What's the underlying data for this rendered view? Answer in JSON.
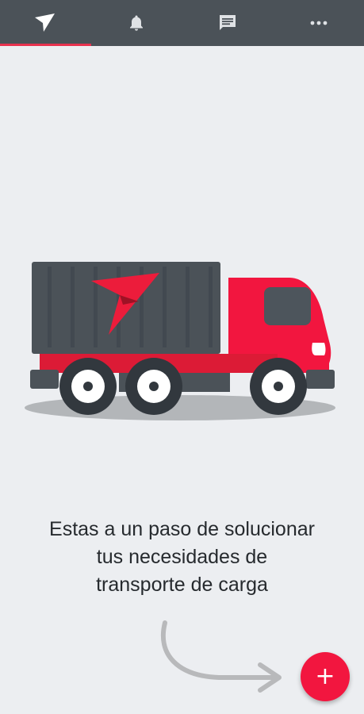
{
  "tabs": [
    {
      "icon": "send-arrow-icon",
      "active": true
    },
    {
      "icon": "bell-icon",
      "active": false
    },
    {
      "icon": "chat-icon",
      "active": false
    },
    {
      "icon": "more-dots-icon",
      "active": false
    }
  ],
  "empty_state": {
    "illustration": "cargo-truck-illustration",
    "message_lines": [
      "Estas a un paso de solucionar",
      "tus necesidades de",
      "transporte de carga"
    ]
  },
  "fab": {
    "label": "+",
    "icon": "plus-icon"
  },
  "colors": {
    "topbar": "#4b5258",
    "accent": "#f2163f",
    "tab_indicator": "#e8324e",
    "background": "#eceef1",
    "text": "#262a2e"
  }
}
